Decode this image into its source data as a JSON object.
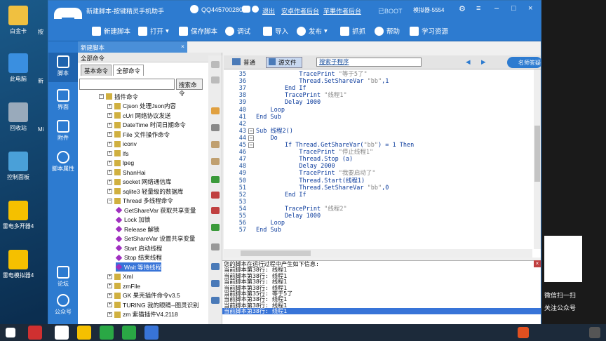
{
  "desktop": {
    "icons": [
      {
        "label": "白金卡"
      },
      {
        "label": "此电脑"
      },
      {
        "label": "回收站"
      },
      {
        "label": "控制面板"
      },
      {
        "label": "雷电多开器4"
      },
      {
        "label": "雷电模拟器4"
      }
    ],
    "partial_labels": [
      "按",
      "新",
      "Mi"
    ]
  },
  "app": {
    "title": "新建脚本-按键精灵手机助手",
    "qq": "QQ445700280",
    "logout": "退出",
    "zuozhe_backend": "安卓作者后台",
    "pingguo_backend": "苹果作者后台",
    "boot": "已BOOT",
    "simulator": "模拟器-5554",
    "toolbar": {
      "new_script": "新建脚本",
      "open": "打开",
      "save": "保存脚本",
      "debug": "调试",
      "import": "导入",
      "publish": "发布",
      "capture": "抓抓",
      "help": "帮助",
      "learn": "学习资源"
    },
    "sidebar": {
      "script": "脚本",
      "ui": "界面",
      "attachment": "附件",
      "properties": "脚本属性",
      "forum": "论坛",
      "account": "公众号"
    },
    "doc_tab": "新建脚本",
    "doc_tab_close": "×",
    "commands_panel": {
      "header": "全部命令",
      "tab_basic": "基本命令",
      "tab_all": "全部命令",
      "search_button": "搜索命令",
      "tree": [
        {
          "label": "插件命令",
          "level": 0
        },
        {
          "label": "Cjson 处理Json内容",
          "level": 1
        },
        {
          "label": "cUrl 网络协议发送",
          "level": 1
        },
        {
          "label": "DateTime 时间日期命令",
          "level": 1
        },
        {
          "label": "File 文件操作命令",
          "level": 1
        },
        {
          "label": "iconv",
          "level": 1
        },
        {
          "label": "lfs",
          "level": 1
        },
        {
          "label": "lpeg",
          "level": 1
        },
        {
          "label": "ShanHai",
          "level": 1
        },
        {
          "label": "socket 网络通信库",
          "level": 1
        },
        {
          "label": "sqlite3 轻量级的数据库",
          "level": 1
        },
        {
          "label": "Thread 多线程命令",
          "level": 1
        },
        {
          "label": "GetShareVar 获取共享变量",
          "level": 2
        },
        {
          "label": "Lock 加锁",
          "level": 2
        },
        {
          "label": "Release 解锁",
          "level": 2
        },
        {
          "label": "SetShareVar 设置共享变量",
          "level": 2
        },
        {
          "label": "Start 启动线程",
          "level": 2
        },
        {
          "label": "Stop 结束线程",
          "level": 2
        },
        {
          "label": "Wait 等待线程",
          "level": 2,
          "selected": true
        },
        {
          "label": "Xml",
          "level": 1
        },
        {
          "label": "zmFile",
          "level": 1
        },
        {
          "label": "GK 果壳插件命令v3.5",
          "level": 1
        },
        {
          "label": "TURING 我的眼睛--图灵识别",
          "level": 1
        },
        {
          "label": "zm 紫猫插件V4.2118",
          "level": 1
        }
      ]
    },
    "editor": {
      "tab_normal": "普通",
      "tab_source": "源文件",
      "dropdown": "搜索子程序",
      "teacher": "名师答疑",
      "lines": [
        {
          "n": "35",
          "code": "            TracePrint \"等于5了\""
        },
        {
          "n": "36",
          "code": "            Thread.SetShareVar \"bb\",1"
        },
        {
          "n": "37",
          "code": "        End If"
        },
        {
          "n": "38",
          "code": "        TracePrint \"线程1\""
        },
        {
          "n": "39",
          "code": "        Delay 1000"
        },
        {
          "n": "40",
          "code": "    Loop"
        },
        {
          "n": "41",
          "code": "End Sub"
        },
        {
          "n": "42",
          "code": ""
        },
        {
          "n": "43",
          "code": "Sub 线程2()"
        },
        {
          "n": "44",
          "code": "    Do"
        },
        {
          "n": "45",
          "code": "        If Thread.GetShareVar(\"bb\") = 1 Then"
        },
        {
          "n": "46",
          "code": "            TracePrint \"停止线程1\""
        },
        {
          "n": "47",
          "code": "            Thread.Stop (a)"
        },
        {
          "n": "48",
          "code": "            Delay 2000"
        },
        {
          "n": "49",
          "code": "            TracePrint \"我要启动了\""
        },
        {
          "n": "50",
          "code": "            Thread.Start(线程1)"
        },
        {
          "n": "51",
          "code": "            Thread.SetShareVar \"bb\",0"
        },
        {
          "n": "52",
          "code": "        End If"
        },
        {
          "n": "53",
          "code": ""
        },
        {
          "n": "54",
          "code": "        TracePrint \"线程2\""
        },
        {
          "n": "55",
          "code": "        Delay 1000"
        },
        {
          "n": "56",
          "code": "    Loop"
        },
        {
          "n": "57",
          "code": "End Sub"
        }
      ]
    },
    "output": {
      "lines": [
        "您的脚本在运行过程中产生如下信息:",
        "当前脚本第38行: 线程1",
        "当前脚本第38行: 线程1",
        "当前脚本第38行: 线程1",
        "当前脚本第38行: 线程1",
        "当前脚本第35行: 等于5了",
        "当前脚本第38行: 线程1",
        "当前脚本第38行: 线程1",
        "当前脚本第38行: 线程1"
      ]
    }
  },
  "right_panel": {
    "text1": "微信扫一扫",
    "text2": "关注公众号"
  },
  "colors": {
    "titlebar": "#2d7bd0",
    "selection": "#3874d8",
    "code": "#0b3b9c"
  }
}
